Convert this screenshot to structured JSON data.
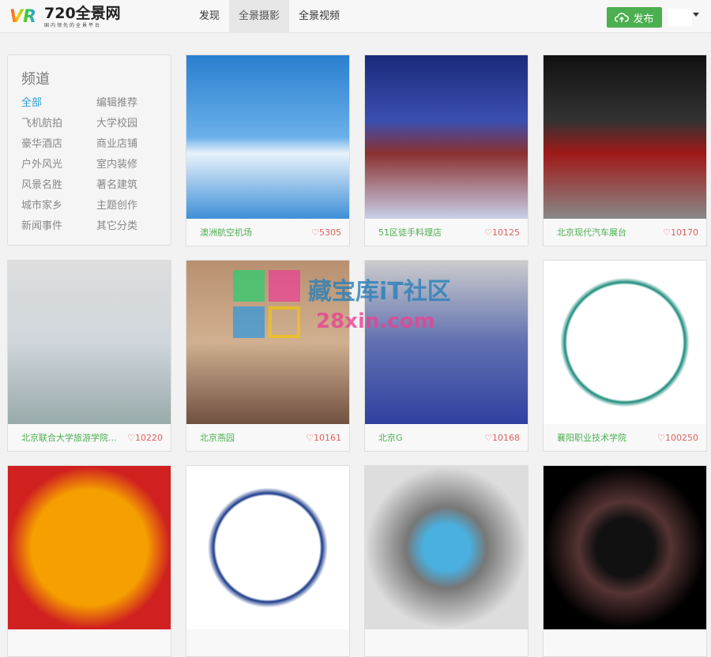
{
  "header": {
    "logo": "720全景网",
    "logo_sub": "国内领先的全景平台",
    "nav": [
      {
        "label": "发现"
      },
      {
        "label": "全景摄影",
        "active": true
      },
      {
        "label": "全景视频"
      }
    ],
    "publish": "发布"
  },
  "sidebar": {
    "title": "频道",
    "categories": [
      "全部",
      "编辑推荐",
      "飞机航拍",
      "大学校园",
      "豪华酒店",
      "商业店铺",
      "户外风光",
      "室内装修",
      "风景名胜",
      "著名建筑",
      "城市家乡",
      "主题创作",
      "新闻事件",
      "其它分类"
    ]
  },
  "cards": [
    {
      "title": "澳洲航空机场",
      "likes": "♡5305",
      "bg": "linear-gradient(#2a7fd0,#6ab0ea 50%,#e8f2fa 60%,#3e8fd8)"
    },
    {
      "title": "51区徒手料理店",
      "likes": "♡10125",
      "bg": "linear-gradient(#1a2a7a,#3a4fb0 40%,#8b3030 60%,#c8d0e8)"
    },
    {
      "title": "北京现代汽车展台",
      "likes": "♡10170",
      "bg": "linear-gradient(#111,#333 40%,#a01818 60%,#888)"
    },
    {
      "title": "北京联合大学旅游学院...",
      "likes": "♡10220",
      "bg": "linear-gradient(#ddd,#cfd6dc 50%,#9aa 100%)"
    },
    {
      "title": "北京燕园",
      "likes": "♡10161",
      "bg": "linear-gradient(#b89070,#d0b090 50%,#705040)"
    },
    {
      "title": "北京G",
      "likes": "♡10168",
      "bg": "linear-gradient(#ccc,#6070b0 50%,#3040a0)"
    },
    {
      "title": "襄阳职业技术学院",
      "likes": "♡100250",
      "bg": "radial-gradient(circle,#fff 50%,#1a8a7a 52%,#fff 56%)"
    },
    {
      "title": "",
      "likes": "",
      "bg": "radial-gradient(circle,#f5a000 50%,#d02020 70%)"
    },
    {
      "title": "",
      "likes": "",
      "bg": "radial-gradient(circle,#fff 45%,#1a3a8a 47%,#fff 52%)"
    },
    {
      "title": "",
      "likes": "",
      "bg": "radial-gradient(circle,#4ab0e0 20%,#777 35%,#ddd 70%)"
    },
    {
      "title": "",
      "likes": "",
      "bg": "radial-gradient(circle,#111 25%,#533 40%,#000 70%)"
    }
  ],
  "watermark": {
    "line1": "藏宝库iT社区",
    "line2": "28xin.com"
  }
}
